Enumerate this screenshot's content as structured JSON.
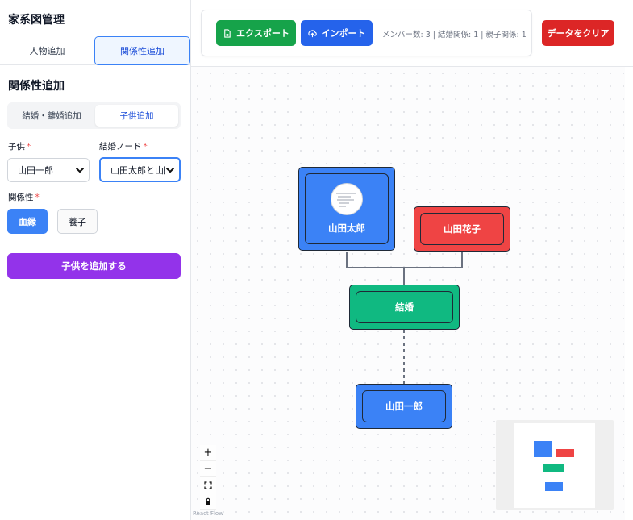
{
  "app": {
    "title": "家系図管理"
  },
  "tabs": {
    "add_person": "人物追加",
    "add_relationship": "関係性追加"
  },
  "relationship": {
    "title": "関係性追加",
    "subtabs": {
      "marriage": "結婚・離婚追加",
      "child": "子供追加"
    },
    "child_label": "子供",
    "child_value": "山田一郎",
    "marriage_node_label": "結婚ノード",
    "marriage_node_value": "山田太郎と山田花子",
    "required_mark": "*",
    "relation_label": "関係性",
    "relation_blood": "血縁",
    "relation_adopted": "養子",
    "submit": "子供を追加する"
  },
  "toolbar": {
    "export": "エクスポート",
    "import": "インポート",
    "stats": "メンバー数: 3 | 結婚関係: 1 | 親子関係: 1",
    "clear": "データをクリア"
  },
  "graph": {
    "nodes": {
      "taro": "山田太郎",
      "hanako": "山田花子",
      "marriage": "結婚",
      "ichiro": "山田一郎"
    }
  },
  "controls": {
    "zoom_in": "+",
    "zoom_out": "−",
    "fit_view_icon": "fit-view-icon",
    "lock_icon": "lock-icon",
    "attribution": "React Flow"
  },
  "colors": {
    "male": "#3b82f6",
    "female": "#ef4444",
    "marriage": "#10b981",
    "export": "#16a34a",
    "import": "#2563eb",
    "clear": "#dc2626",
    "submit": "#9333ea"
  }
}
